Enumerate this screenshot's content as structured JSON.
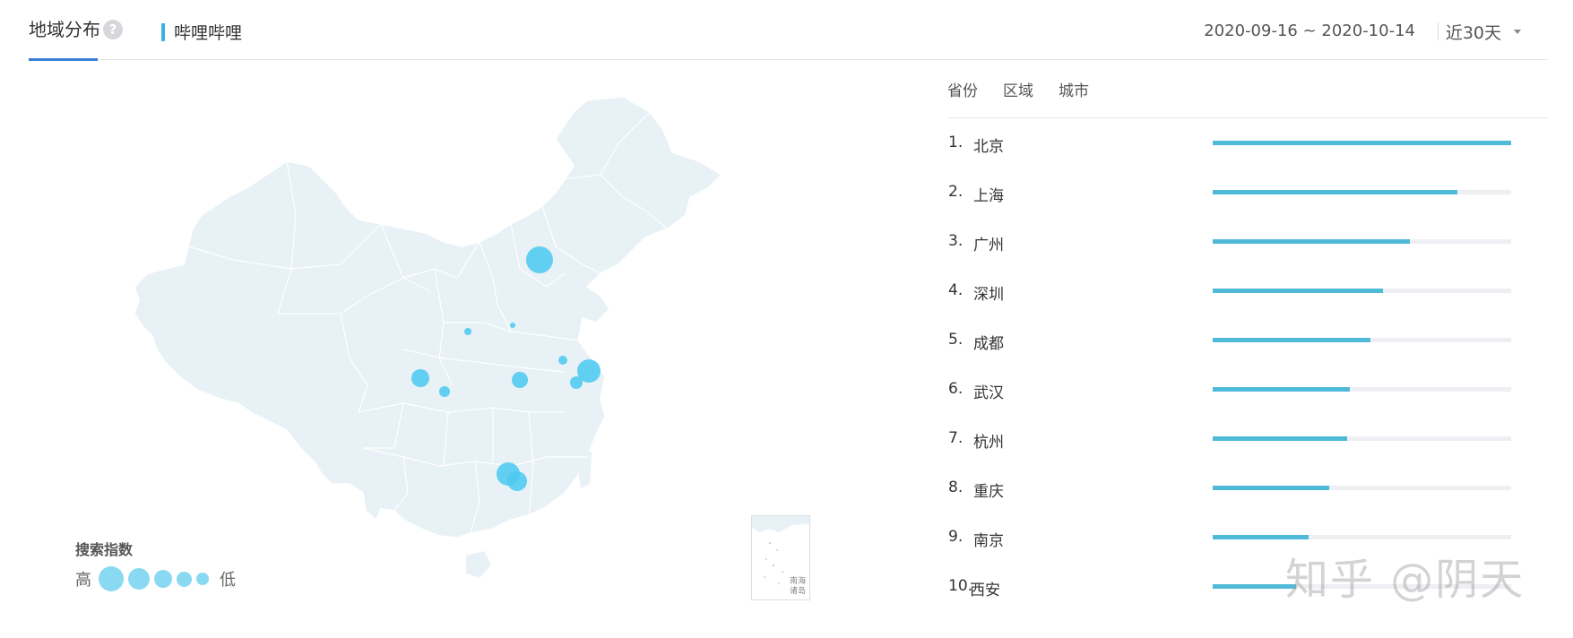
{
  "header": {
    "tab_label": "地域分布",
    "help_icon": "?",
    "keyword": "哔哩哔哩",
    "date_range": "2020-09-16 ~ 2020-10-14",
    "period": "近30天"
  },
  "colors": {
    "accent": "#3c7ed6",
    "bubble": "#4cc9f0",
    "bar": "#4fbad8",
    "map_fill": "#e8f1f5"
  },
  "map": {
    "inset_label": "南海\n诸岛"
  },
  "legend": {
    "title": "搜索指数",
    "high": "高",
    "low": "低"
  },
  "list": {
    "tabs": [
      "省份",
      "区域",
      "城市"
    ],
    "items": [
      {
        "rank": "1.",
        "city": "北京",
        "value": 1.0
      },
      {
        "rank": "2.",
        "city": "上海",
        "value": 0.82
      },
      {
        "rank": "3.",
        "city": "广州",
        "value": 0.66
      },
      {
        "rank": "4.",
        "city": "深圳",
        "value": 0.57
      },
      {
        "rank": "5.",
        "city": "成都",
        "value": 0.53
      },
      {
        "rank": "6.",
        "city": "武汉",
        "value": 0.46
      },
      {
        "rank": "7.",
        "city": "杭州",
        "value": 0.45
      },
      {
        "rank": "8.",
        "city": "重庆",
        "value": 0.39
      },
      {
        "rank": "9.",
        "city": "南京",
        "value": 0.32
      },
      {
        "rank": "10.",
        "city": "西安",
        "value": 0.28
      }
    ]
  },
  "watermark": "知乎 @阴天"
}
